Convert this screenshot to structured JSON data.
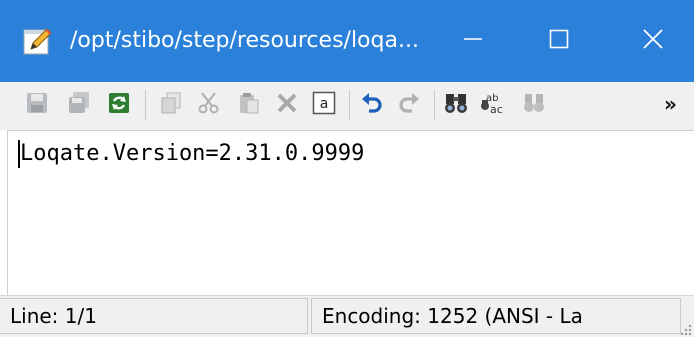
{
  "window": {
    "title": "/opt/stibo/step/resources/loqa...",
    "icon": "notepad-pencil-icon",
    "controls": [
      "minimize-icon",
      "maximize-icon",
      "close-icon"
    ],
    "accent": "#2b80d9"
  },
  "toolbar": {
    "icons": [
      "save-icon",
      "save-all-icon",
      "reload-icon",
      "copy-icon",
      "cut-icon",
      "paste-icon",
      "delete-icon",
      "select-all-icon",
      "undo-icon",
      "redo-icon",
      "find-icon",
      "replace-icon",
      "find-next-icon"
    ],
    "overflow": "»"
  },
  "editor": {
    "lines": [
      "Loqate.Version=2.31.0.9999"
    ]
  },
  "status": {
    "line": "Line: 1/1",
    "encoding": "Encoding: 1252  (ANSI - La"
  }
}
